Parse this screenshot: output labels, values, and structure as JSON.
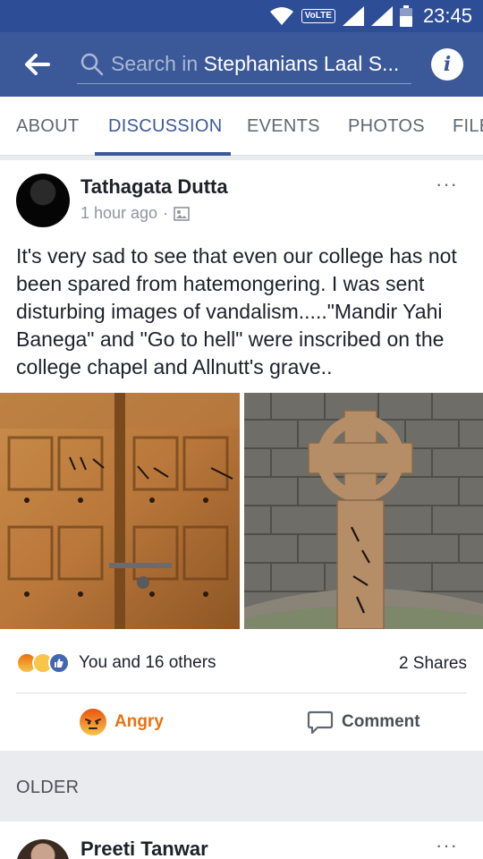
{
  "status_bar": {
    "network_badge": "VoLTE",
    "time": "23:45"
  },
  "app_bar": {
    "search_prefix": "Search in ",
    "search_group": "Stephanians Laal S...",
    "info_label": "i"
  },
  "tabs": [
    {
      "label": "ABOUT",
      "active": false
    },
    {
      "label": "DISCUSSION",
      "active": true
    },
    {
      "label": "EVENTS",
      "active": false
    },
    {
      "label": "PHOTOS",
      "active": false
    },
    {
      "label": "FILES",
      "active": false
    }
  ],
  "post": {
    "author": "Tathagata Dutta",
    "time": "1 hour ago",
    "separator": "·",
    "privacy_icon": "group-photo-icon",
    "more_label": "···",
    "text": "It's very sad to see that even our college has not been spared from hatemongering. I was sent disturbing images of vandalism.....\"Mandir Yahi Banega\" and \"Go to hell\" were inscribed on the college chapel and Allnutt's grave..",
    "reactions_text": "You and 16 others",
    "shares_text": "2 Shares",
    "actions": {
      "angry_label": "Angry",
      "comment_label": "Comment"
    }
  },
  "section": {
    "older_label": "OLDER"
  },
  "next_post": {
    "author": "Preeti Tanwar",
    "more_label": "···"
  },
  "colors": {
    "brand": "#3b5998",
    "status_bar": "#2d4e96",
    "angry": "#e9710f"
  }
}
